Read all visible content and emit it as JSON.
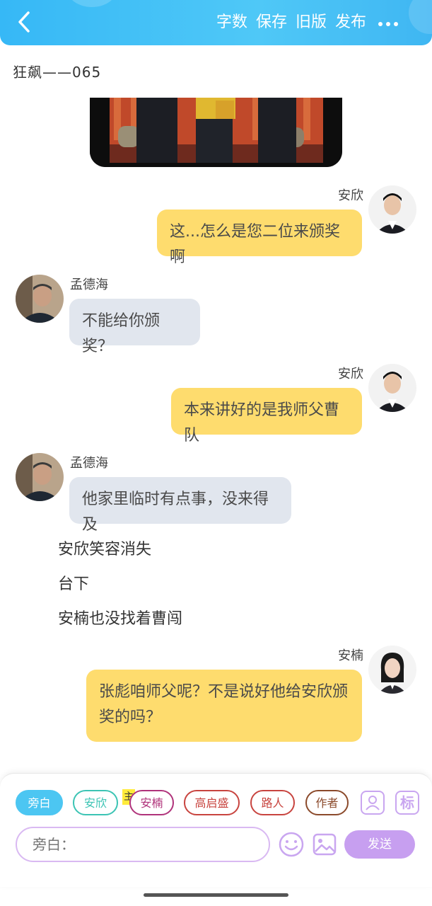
{
  "header": {
    "back_icon": "chevron-left-icon",
    "menu": [
      "字数",
      "保存",
      "旧版",
      "发布"
    ],
    "more_icon": "more-dots-icon"
  },
  "story": {
    "title": "狂飙——065"
  },
  "messages": [
    {
      "speaker": "安欣",
      "text": "这...怎么是您二位来颁奖啊"
    },
    {
      "speaker": "孟德海",
      "text": "不能给你颁奖？"
    },
    {
      "speaker": "安欣",
      "text": "本来讲好的是我师父曹队"
    },
    {
      "speaker": "孟德海",
      "text": "他家里临时有点事，没来得及"
    }
  ],
  "narrations": [
    "安欣笑容消失",
    "台下",
    "安楠也没找着曹闯"
  ],
  "last_message": {
    "speaker": "安楠",
    "text": "张彪咱师父呢？不是说好他给安欣颁奖的吗？"
  },
  "role_chips": [
    "旁白",
    "安欣",
    "安楠",
    "高启盛",
    "路人",
    "作者"
  ],
  "main_badge": "主",
  "tools": {
    "add_role_icon": "add-role-icon",
    "tag_label": "标"
  },
  "input": {
    "placeholder": "旁白："
  },
  "send_label": "发送",
  "colors": {
    "header": "#36b8f6",
    "right_bubble": "#fedc6e",
    "left_bubble": "#e1e6ee",
    "active_chip": "#4cc6f2",
    "send_button": "#c79ff0",
    "chip_borders": [
      "#4cc6f2",
      "#3cc4b4",
      "#b0337b",
      "#c8443f",
      "#c8443f",
      "#8b4a2b"
    ]
  }
}
